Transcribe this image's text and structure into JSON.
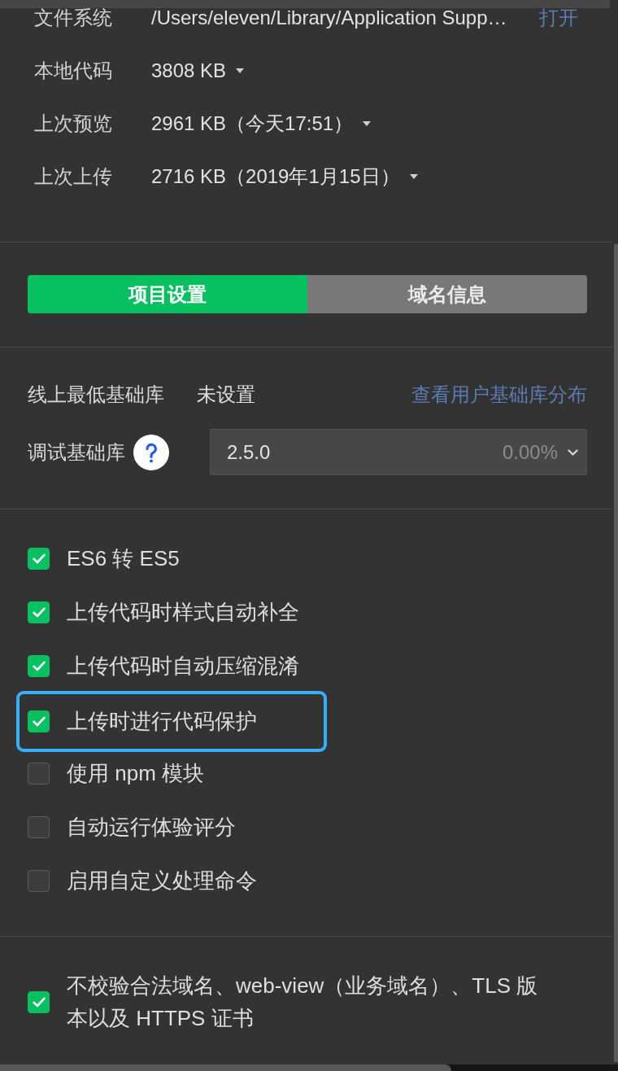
{
  "file_info": [
    {
      "kind": "path",
      "label": "文件系统",
      "value": "/Users/eleven/Library/Application Supp…",
      "action": "打开"
    },
    {
      "kind": "size",
      "label": "本地代码",
      "value": "3808 KB"
    },
    {
      "kind": "size",
      "label": "上次预览",
      "value": "2961 KB（今天17:51）"
    },
    {
      "kind": "size",
      "label": "上次上传",
      "value": "2716 KB（2019年1月15日）"
    }
  ],
  "tabs": [
    {
      "label": "项目设置",
      "selected": true
    },
    {
      "label": "域名信息",
      "selected": false
    }
  ],
  "min_library": {
    "label": "线上最低基础库",
    "value": "未设置",
    "link": "查看用户基础库分布"
  },
  "debug_library": {
    "label": "调试基础库",
    "version": "2.5.0",
    "usage": "0.00%"
  },
  "options": [
    {
      "label": "ES6 转 ES5",
      "checked": true,
      "highlighted": false
    },
    {
      "label": "上传代码时样式自动补全",
      "checked": true,
      "highlighted": false
    },
    {
      "label": "上传代码时自动压缩混淆",
      "checked": true,
      "highlighted": false
    },
    {
      "label": "上传时进行代码保护",
      "checked": true,
      "highlighted": true
    },
    {
      "label": "使用 npm 模块",
      "checked": false,
      "highlighted": false
    },
    {
      "label": "自动运行体验评分",
      "checked": false,
      "highlighted": false
    },
    {
      "label": "启用自定义处理命令",
      "checked": false,
      "highlighted": false
    }
  ],
  "domain_option": {
    "label": "不校验合法域名、web-view（业务域名）、TLS 版本以及 HTTPS 证书",
    "checked": true
  }
}
